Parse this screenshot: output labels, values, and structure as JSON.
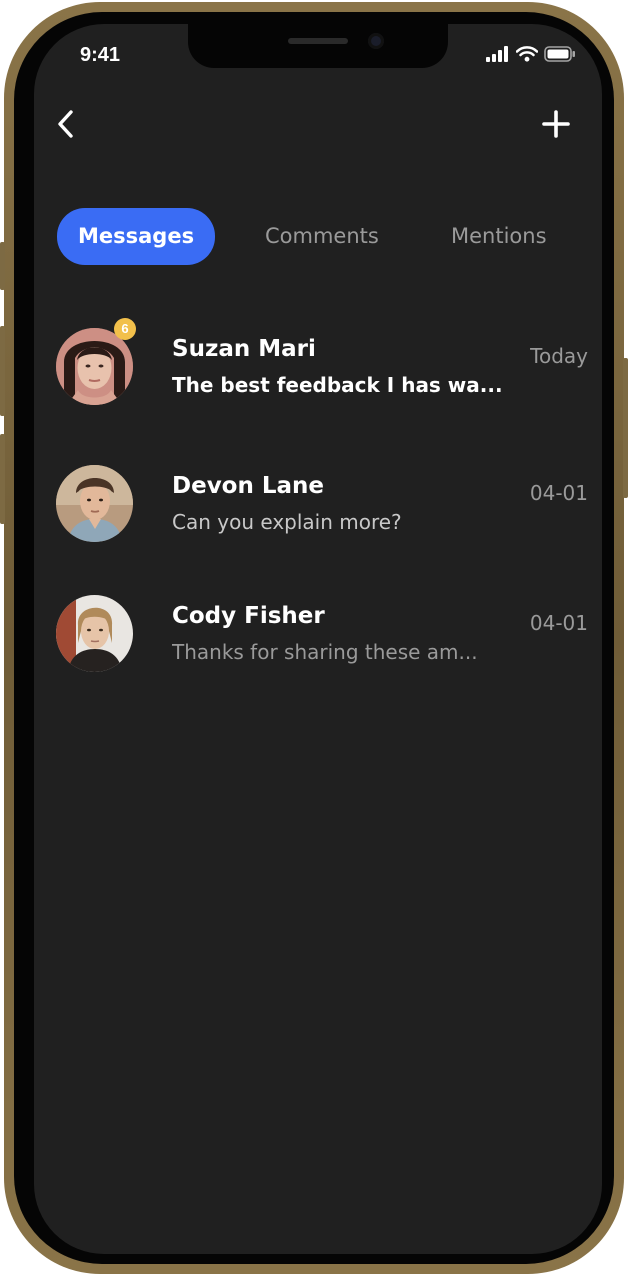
{
  "status_bar": {
    "time": "9:41",
    "icons": [
      "signal-icon",
      "wifi-icon",
      "battery-icon"
    ]
  },
  "nav": {
    "back_icon": "chevron-left-icon",
    "add_icon": "plus-icon"
  },
  "tabs": [
    {
      "label": "Messages",
      "active": true
    },
    {
      "label": "Comments",
      "active": false
    },
    {
      "label": "Mentions",
      "active": false
    }
  ],
  "conversations": [
    {
      "name": "Suzan Mari",
      "date": "Today",
      "preview": "The best feedback I has wa...",
      "unread_count": "6",
      "unread": true
    },
    {
      "name": "Devon Lane",
      "date": "04-01",
      "preview": "Can you explain more?",
      "unread": false
    },
    {
      "name": "Cody Fisher",
      "date": "04-01",
      "preview": "Thanks for sharing these am...",
      "unread": false
    }
  ],
  "colors": {
    "background": "#202020",
    "accent": "#3a6cf4",
    "badge": "#f2c04b",
    "frame": "#7d6a43"
  }
}
